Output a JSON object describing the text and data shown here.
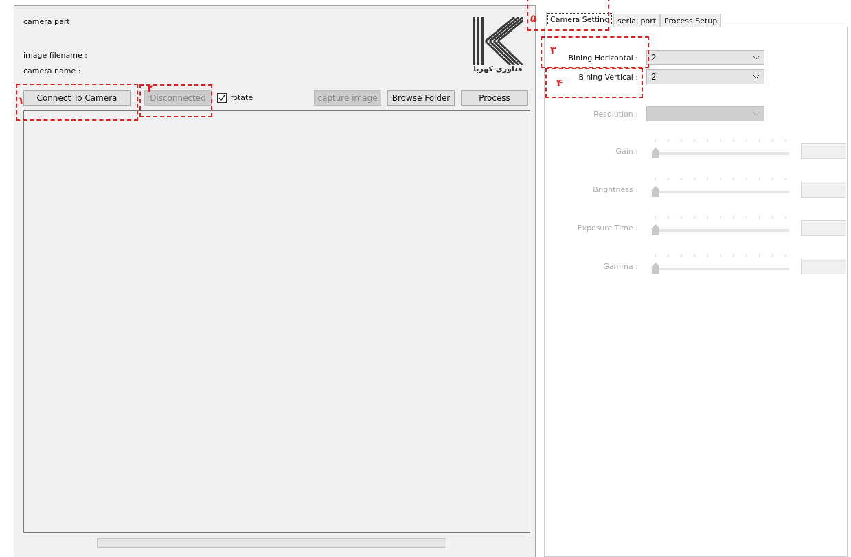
{
  "camera_panel": {
    "title": "camera part",
    "image_filename_label": "image filename :",
    "camera_name_label": "camera name :",
    "logo_text": "فناوری کهربا",
    "buttons": [
      {
        "label": "Connect To Camera",
        "disabled": false
      },
      {
        "label": "Disconnected",
        "disabled": true
      }
    ],
    "rotate": {
      "label": "rotate",
      "checked": true
    },
    "right_buttons": [
      {
        "label": "capture image",
        "disabled": true
      },
      {
        "label": "Browse Folder",
        "disabled": false
      },
      {
        "label": "Process",
        "disabled": false
      }
    ]
  },
  "tabs": [
    {
      "label": "Camera Setting",
      "selected": true
    },
    {
      "label": "serial port",
      "selected": false
    },
    {
      "label": "Process Setup",
      "selected": false
    }
  ],
  "settings": [
    {
      "label": "Bining Horizontal :",
      "value": "2",
      "disabled": false
    },
    {
      "label": "Bining Vertical :",
      "value": "2",
      "disabled": false
    },
    {
      "label": "Resolution :",
      "disabled": true
    }
  ],
  "sliders": [
    {
      "label": "Gain :",
      "level": 0,
      "disabled": true
    },
    {
      "label": "Brightness :",
      "level": 0,
      "disabled": true
    },
    {
      "label": "Exposure Time :",
      "level": 0,
      "disabled": true
    },
    {
      "label": "Gamma :",
      "level": 0,
      "disabled": true
    }
  ],
  "annotations": [
    {
      "number": "۱"
    },
    {
      "number": "۲"
    },
    {
      "number": "۳"
    },
    {
      "number": "۴"
    },
    {
      "number": "۵"
    }
  ]
}
